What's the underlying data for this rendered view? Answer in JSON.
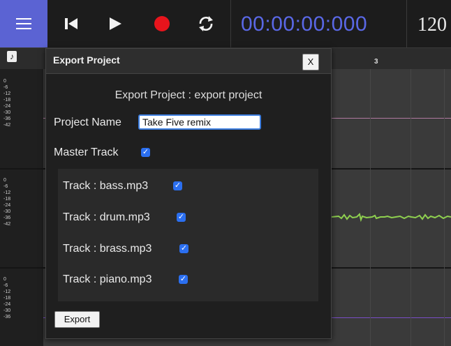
{
  "toolbar": {
    "timecode": "00:00:00:000",
    "bpm": "120"
  },
  "ruler": {
    "marker": "3"
  },
  "meter_labels": [
    "0",
    "-6",
    "-12",
    "-18",
    "-24",
    "-30",
    "-36",
    "-42"
  ],
  "dialog": {
    "title": "Export Project",
    "close_label": "X",
    "subtitle": "Export Project : export project",
    "project_name_label": "Project Name",
    "project_name_value": "Take Five remix",
    "master_track_label": "Master Track",
    "master_track_checked": true,
    "tracks": [
      {
        "label": "Track : bass.mp3",
        "checked": true
      },
      {
        "label": "Track : drum.mp3",
        "checked": true
      },
      {
        "label": "Track : brass.mp3",
        "checked": true
      },
      {
        "label": "Track : piano.mp3",
        "checked": true
      }
    ],
    "export_label": "Export"
  },
  "colors": {
    "accent": "#5b63d3",
    "timecode": "#5a68e6",
    "record": "#e8141c",
    "checkbox": "#2b6ff0",
    "waveform": "#8fd14f",
    "lane_line_pink": "#b07aa0",
    "lane_line_purple": "#7a4ec8"
  },
  "icons": {
    "menu": "menu-icon",
    "skip_back": "skip-back-icon",
    "play": "play-icon",
    "record": "record-icon",
    "loop": "loop-icon",
    "note": "music-note-icon"
  }
}
